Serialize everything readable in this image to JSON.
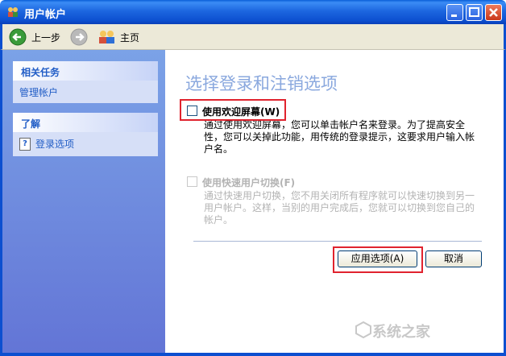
{
  "window": {
    "title": "用户帐户"
  },
  "toolbar": {
    "back_label": "上一步",
    "home_label": "主页"
  },
  "sidebar": {
    "related_tasks": {
      "heading": "相关任务",
      "items": [
        "管理帐户"
      ]
    },
    "learn": {
      "heading": "了解",
      "items": [
        "登录选项"
      ]
    }
  },
  "main": {
    "title": "选择登录和注销选项",
    "option_welcome": {
      "label": "使用欢迎屏幕(W)",
      "description": "通过使用欢迎屏幕，您可以单击帐户名来登录。为了提高安全性，您可以关掉此功能，用传统的登录提示，这要求用户输入帐户名。",
      "checked": false
    },
    "option_fast_switch": {
      "label": "使用快速用户切换(F)",
      "description": "通过快速用户切换，您不用关闭所有程序就可以快速切换到另一用户帐户。这样，当别的用户完成后，您就可以切换到您自己的帐户。",
      "checked": false,
      "enabled": false
    },
    "apply_button": "应用选项(A)",
    "cancel_button": "取消"
  },
  "watermark": {
    "text": "系统之家"
  }
}
